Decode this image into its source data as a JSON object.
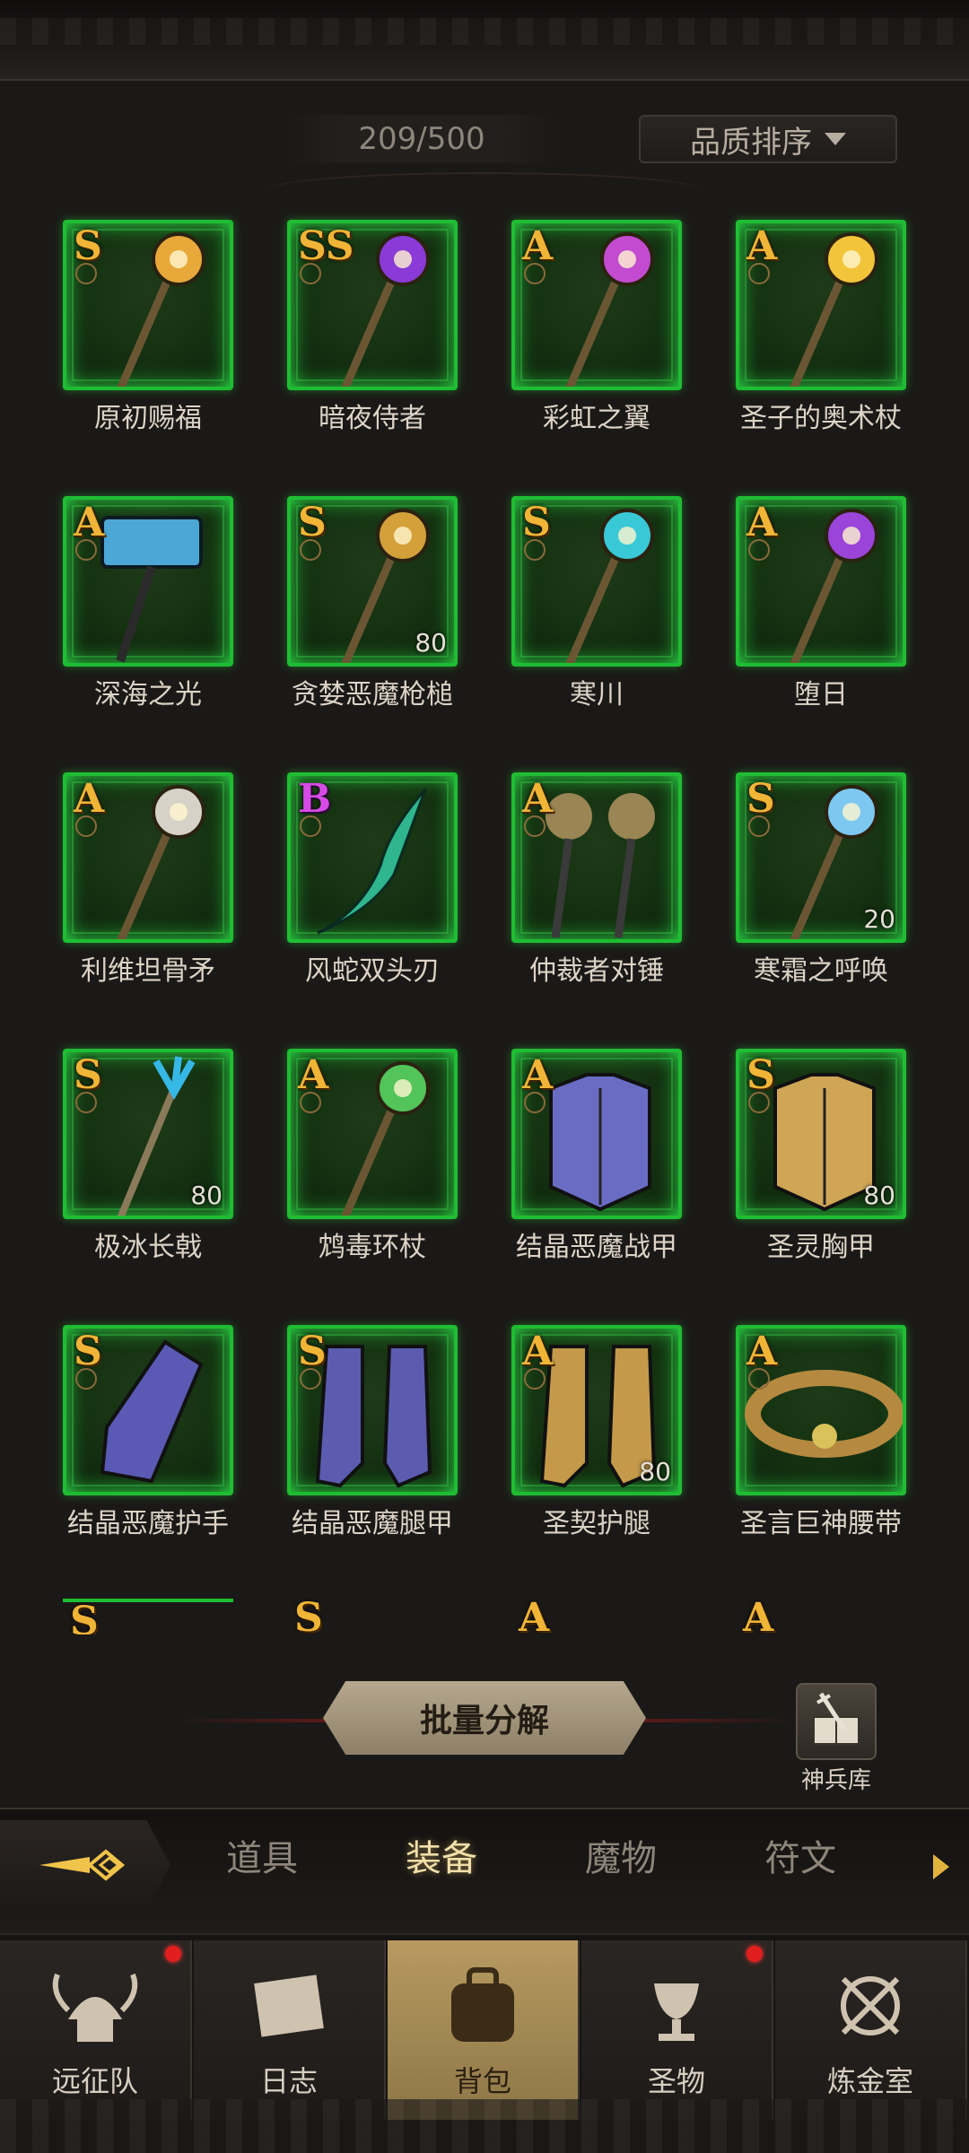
{
  "header": {
    "capacity": "209/500",
    "sort_label": "品质排序"
  },
  "items": [
    {
      "name": "原初赐福",
      "grade": "S",
      "level": "",
      "icon": "golden-staff-icon",
      "color": "#e8a93a"
    },
    {
      "name": "暗夜侍者",
      "grade": "SS",
      "level": "",
      "icon": "dark-scepter-icon",
      "color": "#8a3ad6"
    },
    {
      "name": "彩虹之翼",
      "grade": "A",
      "level": "",
      "icon": "winged-staff-icon",
      "color": "#c24bd0"
    },
    {
      "name": "圣子的奥术杖",
      "grade": "A",
      "level": "",
      "icon": "sun-staff-icon",
      "color": "#f2c43a"
    },
    {
      "name": "深海之光",
      "grade": "A",
      "level": "",
      "icon": "hammer-icon",
      "color": "#4da7d6"
    },
    {
      "name": "贪婪恶魔枪槌",
      "grade": "S",
      "level": "80",
      "icon": "spear-icon",
      "color": "#d4a03a"
    },
    {
      "name": "寒川",
      "grade": "S",
      "level": "",
      "icon": "ice-staff-icon",
      "color": "#39c9d6"
    },
    {
      "name": "堕日",
      "grade": "A",
      "level": "",
      "icon": "void-staff-icon",
      "color": "#9a44d9"
    },
    {
      "name": "利维坦骨矛",
      "grade": "A",
      "level": "",
      "icon": "bone-spear-icon",
      "color": "#d6d2c8"
    },
    {
      "name": "风蛇双头刃",
      "grade": "B",
      "level": "",
      "icon": "serpent-blade-icon",
      "color": "#2fb68e"
    },
    {
      "name": "仲裁者对锤",
      "grade": "A",
      "level": "",
      "icon": "twin-mace-icon",
      "color": "#9a8554"
    },
    {
      "name": "寒霜之呼唤",
      "grade": "S",
      "level": "20",
      "icon": "frost-staff-icon",
      "color": "#7dc8f0"
    },
    {
      "name": "极冰长戟",
      "grade": "S",
      "level": "80",
      "icon": "trident-icon",
      "color": "#36b8e6"
    },
    {
      "name": "鸩毒环杖",
      "grade": "A",
      "level": "",
      "icon": "poison-staff-icon",
      "color": "#52c45a"
    },
    {
      "name": "结晶恶魔战甲",
      "grade": "A",
      "level": "",
      "icon": "armor-icon",
      "color": "#6a6cc4"
    },
    {
      "name": "圣灵胸甲",
      "grade": "S",
      "level": "80",
      "icon": "breastplate-icon",
      "color": "#cfa556"
    },
    {
      "name": "结晶恶魔护手",
      "grade": "S",
      "level": "",
      "icon": "gauntlet-icon",
      "color": "#5a5ab4"
    },
    {
      "name": "结晶恶魔腿甲",
      "grade": "S",
      "level": "",
      "icon": "boots-icon",
      "color": "#5b5cb0"
    },
    {
      "name": "圣契护腿",
      "grade": "A",
      "level": "80",
      "icon": "greaves-icon",
      "color": "#c49a4a"
    },
    {
      "name": "圣言巨神腰带",
      "grade": "A",
      "level": "",
      "icon": "belt-icon",
      "color": "#b58a40"
    }
  ],
  "partial_row": [
    {
      "grade": "S"
    },
    {
      "grade": "S"
    },
    {
      "grade": "A"
    },
    {
      "grade": "A"
    }
  ],
  "actions": {
    "bulk_label": "批量分解",
    "armory_label": "神兵库"
  },
  "tabs": [
    {
      "label": "道具",
      "active": false
    },
    {
      "label": "装备",
      "active": true
    },
    {
      "label": "魔物",
      "active": false
    },
    {
      "label": "符文",
      "active": false
    }
  ],
  "nav": [
    {
      "label": "远征队",
      "icon": "viking-helmet-icon",
      "badge": true,
      "active": false
    },
    {
      "label": "日志",
      "icon": "scroll-icon",
      "badge": false,
      "active": false
    },
    {
      "label": "背包",
      "icon": "backpack-icon",
      "badge": false,
      "active": true
    },
    {
      "label": "圣物",
      "icon": "chalice-icon",
      "badge": true,
      "active": false
    },
    {
      "label": "炼金室",
      "icon": "alchemy-icon",
      "badge": false,
      "active": false
    }
  ],
  "colors": {
    "slot_border": "#1fbd33",
    "grade_gold": "#f0b437",
    "grade_purple": "#d64be6",
    "accent_active_tab": "#f0dfa8",
    "nav_active": "#b79a60"
  }
}
